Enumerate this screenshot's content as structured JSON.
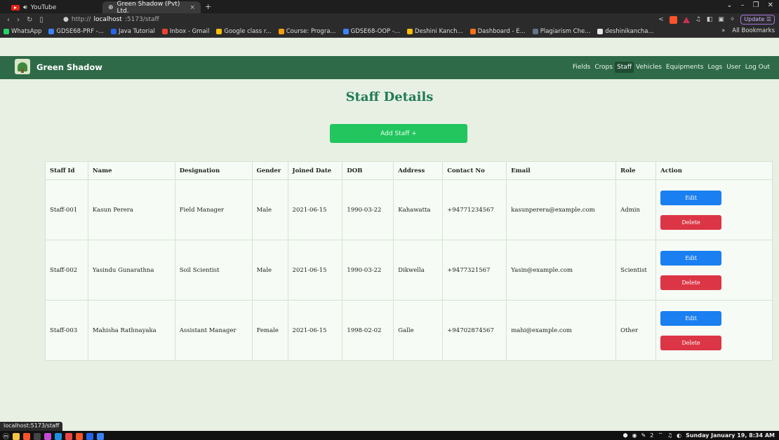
{
  "browser": {
    "tabs": [
      {
        "label": "YouTube",
        "active": false
      },
      {
        "label": "Green Shadow (Pvt) Ltd.",
        "active": true
      }
    ],
    "new_tab": "+",
    "url_scheme": "http://",
    "url_host": "localhost",
    "url_path": ":5173/staff",
    "update_label": "Update",
    "bookmarks": [
      {
        "label": "WhatsApp",
        "color": "#25d366"
      },
      {
        "label": "GDSE68-PRF -...",
        "color": "#3b82f6"
      },
      {
        "label": "Java Tutorial",
        "color": "#2563eb"
      },
      {
        "label": "Inbox - Gmail",
        "color": "#ea4335"
      },
      {
        "label": "Google class r...",
        "color": "#fbbc05"
      },
      {
        "label": "Course: Progra...",
        "color": "#f59e0b"
      },
      {
        "label": "GDSE68-OOP -...",
        "color": "#3b82f6"
      },
      {
        "label": "Deshini Kanch...",
        "color": "#fbbc05"
      },
      {
        "label": "Dashboard - E...",
        "color": "#f97316"
      },
      {
        "label": "Plagiarism Che...",
        "color": "#64748b"
      },
      {
        "label": "deshinikancha...",
        "color": "#e5e7eb"
      }
    ],
    "bookmarks_more": "»",
    "all_bookmarks": "All Bookmarks"
  },
  "app": {
    "brand": "Green Shadow",
    "nav": [
      {
        "label": "Fields",
        "active": false
      },
      {
        "label": "Crops",
        "active": false
      },
      {
        "label": "Staff",
        "active": true
      },
      {
        "label": "Vehicles",
        "active": false
      },
      {
        "label": "Equipments",
        "active": false
      },
      {
        "label": "Logs",
        "active": false
      },
      {
        "label": "User",
        "active": false
      },
      {
        "label": "Log Out",
        "active": false
      }
    ],
    "page_title": "Staff Details",
    "add_button": "Add Staff +",
    "table": {
      "headers": [
        "Staff Id",
        "Name",
        "Designation",
        "Gender",
        "Joined Date",
        "DOB",
        "Address",
        "Contact No",
        "Email",
        "Role",
        "Action"
      ],
      "rows": [
        [
          "Staff-001",
          "Kasun Perera",
          "Field Manager",
          "Male",
          "2021-06-15",
          "1990-03-22",
          "Kahawatta",
          "+94771234567",
          "kasunperera@example.com",
          "Admin"
        ],
        [
          "Staff-002",
          "Yasindu Gunarathna",
          "Soil Scientist",
          "Male",
          "2021-06-15",
          "1990-03-22",
          "Dikwella",
          "+9477321567",
          "Yasin@example.com",
          "Scientist"
        ],
        [
          "Staff-003",
          "Mahisha Rathnayaka",
          "Assistant Manager",
          "Female",
          "2021-06-15",
          "1998-02-02",
          "Galle",
          "+94702874567",
          "mahi@example.com",
          "Other"
        ]
      ],
      "edit_label": "Edit",
      "delete_label": "Delete"
    }
  },
  "status_url": "localhost:5173/staff",
  "taskbar": {
    "clock": "Sunday January 19, 8:34 AM",
    "notification_count": "2"
  },
  "colors": {
    "navbar": "#2f6a48",
    "title": "#1f7a55",
    "add_button": "#22c55e",
    "edit_button": "#1a7ff0",
    "delete_button": "#dc3545"
  }
}
